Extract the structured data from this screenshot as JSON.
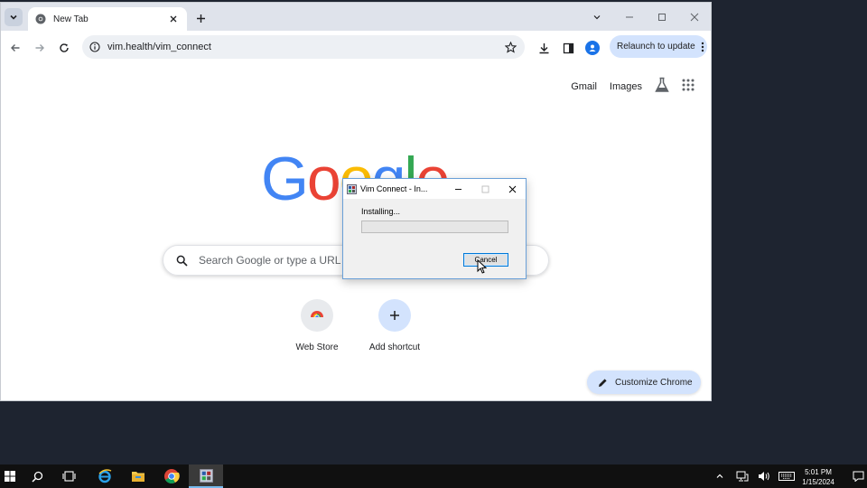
{
  "browser": {
    "tab": {
      "title": "New Tab"
    },
    "address_bar": {
      "url": "vim.health/vim_connect"
    },
    "relaunch_label": "Relaunch to update"
  },
  "newtab": {
    "top_links": {
      "gmail": "Gmail",
      "images": "Images"
    },
    "logo_letters": [
      "G",
      "o",
      "o",
      "g",
      "l",
      "e"
    ],
    "search_placeholder": "Search Google or type a URL",
    "shortcuts": [
      {
        "label": "Web Store",
        "icon": "chrome-web-store-icon"
      },
      {
        "label": "Add shortcut",
        "icon": "plus-icon"
      }
    ],
    "customize_label": "Customize Chrome"
  },
  "dialog": {
    "title": "Vim Connect - In...",
    "status": "Installing...",
    "progress": 0,
    "cancel_label": "Cancel"
  },
  "taskbar": {
    "time": "5:01 PM",
    "date": "1/15/2024"
  },
  "colors": {
    "accent": "#1a73e8",
    "pill_bg": "#d3e3fd",
    "google_blue": "#4285f4",
    "google_red": "#ea4335",
    "google_yellow": "#fbbc05",
    "google_green": "#34a853"
  }
}
